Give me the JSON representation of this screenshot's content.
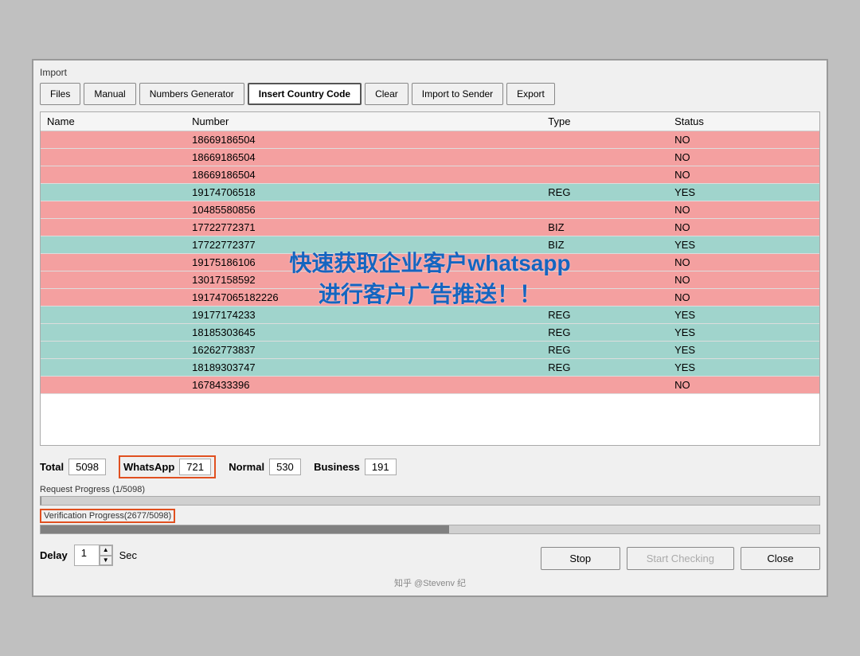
{
  "window": {
    "section_label": "Import"
  },
  "toolbar": {
    "buttons": [
      {
        "id": "files",
        "label": "Files",
        "active": false
      },
      {
        "id": "manual",
        "label": "Manual",
        "active": false
      },
      {
        "id": "numbers-generator",
        "label": "Numbers Generator",
        "active": false
      },
      {
        "id": "insert-country-code",
        "label": "Insert Country Code",
        "active": true
      },
      {
        "id": "clear",
        "label": "Clear",
        "active": false
      },
      {
        "id": "import-to-sender",
        "label": "Import to Sender",
        "active": false
      },
      {
        "id": "export",
        "label": "Export",
        "active": false
      }
    ]
  },
  "table": {
    "headers": [
      "Name",
      "Number",
      "Type",
      "Status"
    ],
    "rows": [
      {
        "name": "",
        "number": "18669186504",
        "type": "",
        "status": "NO",
        "style": "red"
      },
      {
        "name": "",
        "number": "18669186504",
        "type": "",
        "status": "NO",
        "style": "red"
      },
      {
        "name": "",
        "number": "18669186504",
        "type": "",
        "status": "NO",
        "style": "red"
      },
      {
        "name": "",
        "number": "19174706518",
        "type": "REG",
        "status": "YES",
        "style": "teal"
      },
      {
        "name": "",
        "number": "10485580856",
        "type": "",
        "status": "NO",
        "style": "red"
      },
      {
        "name": "",
        "number": "17722772371",
        "type": "BIZ",
        "status": "NO",
        "style": "red"
      },
      {
        "name": "",
        "number": "17722772377",
        "type": "BIZ",
        "status": "YES",
        "style": "teal"
      },
      {
        "name": "",
        "number": "19175186106",
        "type": "",
        "status": "NO",
        "style": "red"
      },
      {
        "name": "",
        "number": "13017158592",
        "type": "",
        "status": "NO",
        "style": "red"
      },
      {
        "name": "",
        "number": "191747065182226",
        "type": "",
        "status": "NO",
        "style": "red"
      },
      {
        "name": "",
        "number": "19177174233",
        "type": "REG",
        "status": "YES",
        "style": "teal"
      },
      {
        "name": "",
        "number": "18185303645",
        "type": "REG",
        "status": "YES",
        "style": "teal"
      },
      {
        "name": "",
        "number": "16262773837",
        "type": "REG",
        "status": "YES",
        "style": "teal"
      },
      {
        "name": "",
        "number": "18189303747",
        "type": "REG",
        "status": "YES",
        "style": "teal"
      },
      {
        "name": "",
        "number": "1678433396",
        "type": "",
        "status": "NO",
        "style": "red"
      }
    ]
  },
  "watermark": {
    "line1": "快速获取企业客户whatsapp",
    "line2": "进行客户广告推送！！"
  },
  "stats": {
    "total_label": "Total",
    "total_value": "5098",
    "whatsapp_label": "WhatsApp",
    "whatsapp_value": "721",
    "normal_label": "Normal",
    "normal_value": "530",
    "business_label": "Business",
    "business_value": "191"
  },
  "progress": {
    "request_label": "Request Progress (1/5098)",
    "request_percent": 0.02,
    "verification_label": "Verification Progress(2677/5098)",
    "verification_percent": 52.5
  },
  "delay": {
    "label": "Delay",
    "value": "1",
    "unit": "Sec"
  },
  "bottom_buttons": {
    "stop": "Stop",
    "start_checking": "Start Checking",
    "close": "Close"
  },
  "watermark_source": "知乎 @Stevenv 纪"
}
